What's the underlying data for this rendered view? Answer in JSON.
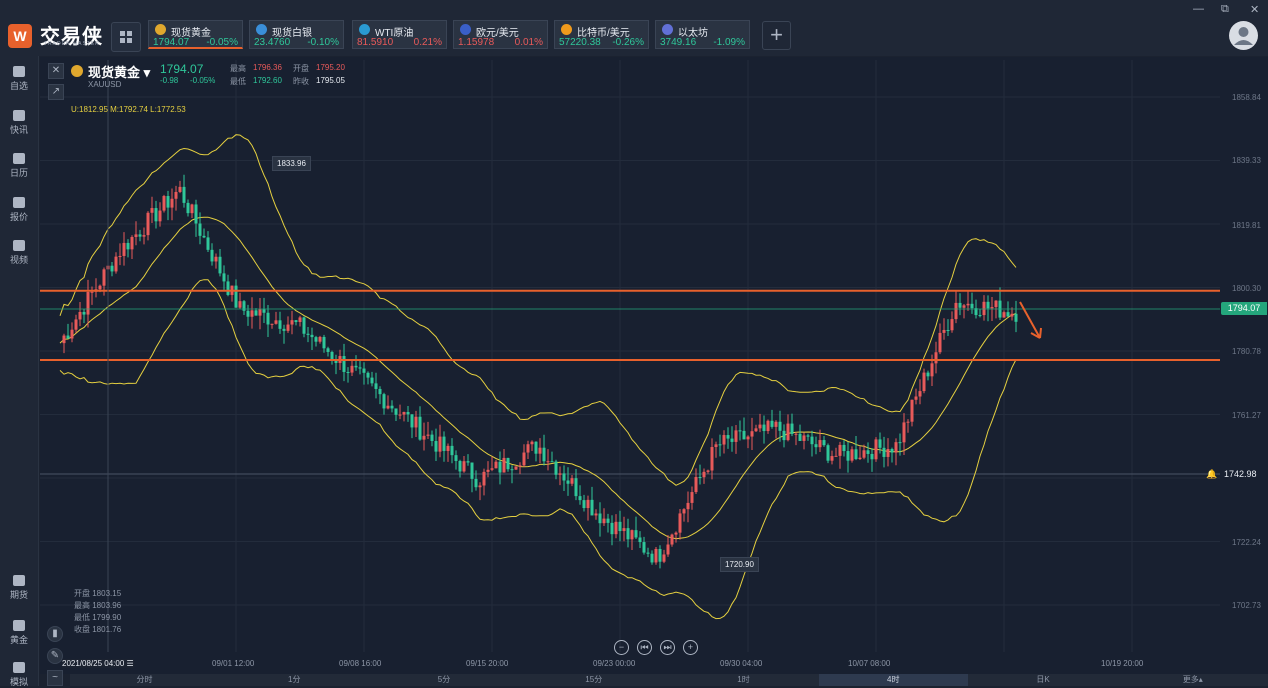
{
  "app": {
    "brand": "交易侠",
    "brand_sub": "TRADER MASTER"
  },
  "tickers": [
    {
      "name": "现货黄金",
      "price": "1794.07",
      "change": "-0.05%",
      "dir": "dn",
      "icon_color": "#e0a82e"
    },
    {
      "name": "现货白银",
      "price": "23.4760",
      "change": "-0.10%",
      "dir": "dn",
      "icon_color": "#3a8fd9"
    },
    {
      "name": "WTI原油",
      "price": "81.5910",
      "change": "0.21%",
      "dir": "up",
      "icon_color": "#2a9ad1"
    },
    {
      "name": "欧元/美元",
      "price": "1.15978",
      "change": "0.01%",
      "dir": "up",
      "icon_color": "#3a5fc8"
    },
    {
      "name": "比特币/美元",
      "price": "57220.38",
      "change": "-0.26%",
      "dir": "dn",
      "icon_color": "#f09a1c"
    },
    {
      "name": "以太坊",
      "price": "3749.16",
      "change": "-1.09%",
      "dir": "dn",
      "icon_color": "#6270d6"
    }
  ],
  "sidebar": [
    {
      "label": "自选",
      "icon": "bookmark-icon"
    },
    {
      "label": "快讯",
      "icon": "news-icon"
    },
    {
      "label": "日历",
      "icon": "calendar-icon"
    },
    {
      "label": "报价",
      "icon": "quote-icon"
    },
    {
      "label": "视频",
      "icon": "video-icon"
    },
    {
      "label": "期货",
      "icon": "futures-icon"
    },
    {
      "label": "黄金",
      "icon": "gold-icon"
    },
    {
      "label": "模拟",
      "icon": "wallet-icon"
    }
  ],
  "instrument": {
    "name": "现货黄金",
    "code": "XAUUSD",
    "price": "1794.07",
    "change": "-0.98",
    "change_pct": "-0.05%",
    "high_label": "最高",
    "high": "1796.36",
    "open_label": "开盘",
    "open": "1795.20",
    "low_label": "最低",
    "low": "1792.60",
    "prev_label": "昨收",
    "prev": "1795.05",
    "bands": "U:1812.95  M:1792.74  L:1772.53"
  },
  "y_axis": [
    "1858.84",
    "1839.33",
    "1819.81",
    "1800.30",
    "1780.78",
    "1761.27",
    "1741.76",
    "1722.24",
    "1702.73"
  ],
  "price_tag": "1794.07",
  "alert_price": "1742.98",
  "callouts": {
    "high": "1833.96",
    "low": "1720.90"
  },
  "x_axis": [
    {
      "label": "2021/08/25 04:00 ☰"
    },
    {
      "label": "09/01 12:00"
    },
    {
      "label": "09/08 16:00"
    },
    {
      "label": "09/15 20:00"
    },
    {
      "label": "09/23 00:00"
    },
    {
      "label": "09/30 04:00"
    },
    {
      "label": "10/07 08:00"
    },
    {
      "label": "10/19 20:00"
    }
  ],
  "bottom_ohlc": {
    "open": "开盘 1803.15",
    "high": "最高 1803.96",
    "low": "最低 1799.90",
    "close": "收盘 1801.76"
  },
  "timeframes": [
    "分时",
    "1分",
    "5分",
    "15分",
    "1时",
    "4时",
    "日K",
    "更多▴"
  ],
  "selected_timeframe": "4时",
  "colors": {
    "up": "#e85a5a",
    "down": "#2fc79a",
    "band": "#e5d040",
    "level": "#e8612c"
  },
  "chart_data": {
    "type": "candlestick",
    "description_series": "XAUUSD 4H candles with Bollinger bands",
    "x": [
      "08/25",
      "09/01",
      "09/08",
      "09/15",
      "09/23",
      "09/30",
      "10/07",
      "10/19"
    ],
    "close_approx": [
      1785,
      1812,
      1830,
      1795,
      1790,
      1775,
      1760,
      1745,
      1755,
      1735,
      1722,
      1755,
      1760,
      1752,
      1755,
      1797,
      1794
    ],
    "levels": [
      1800.3,
      1780.0
    ],
    "ylim": [
      1695,
      1865
    ]
  }
}
